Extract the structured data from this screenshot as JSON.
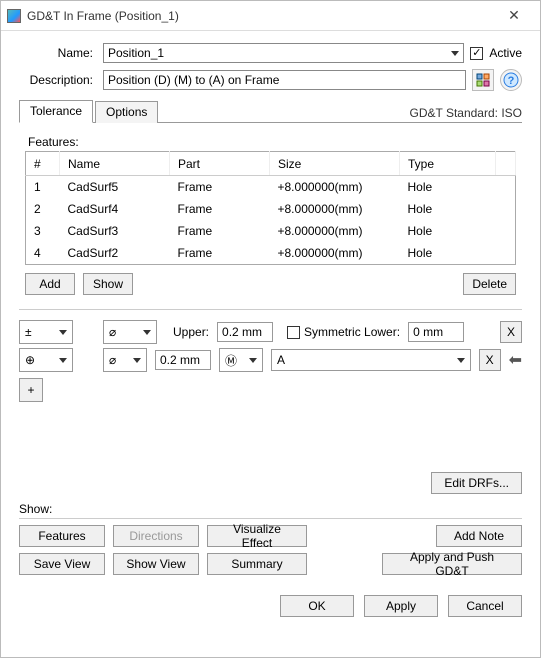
{
  "window": {
    "title": "GD&T In Frame (Position_1)"
  },
  "header": {
    "name_label": "Name:",
    "name_value": "Position_1",
    "active_label": "Active",
    "active_checked": true,
    "desc_label": "Description:",
    "desc_value": "Position (D) (M) to (A) on Frame"
  },
  "tabs": {
    "tolerance": "Tolerance",
    "options": "Options",
    "standard_label": "GD&T Standard: ISO"
  },
  "features": {
    "legend": "Features:",
    "columns": [
      "#",
      "Name",
      "Part",
      "Size",
      "Type"
    ],
    "rows": [
      {
        "n": "1",
        "name": "CadSurf5",
        "part": "Frame",
        "size": "+8.000000(mm)",
        "type": "Hole"
      },
      {
        "n": "2",
        "name": "CadSurf4",
        "part": "Frame",
        "size": "+8.000000(mm)",
        "type": "Hole"
      },
      {
        "n": "3",
        "name": "CadSurf3",
        "part": "Frame",
        "size": "+8.000000(mm)",
        "type": "Hole"
      },
      {
        "n": "4",
        "name": "CadSurf2",
        "part": "Frame",
        "size": "+8.000000(mm)",
        "type": "Hole"
      }
    ],
    "buttons": {
      "add": "Add",
      "show": "Show",
      "delete": "Delete"
    }
  },
  "tolerance_block": {
    "row1": {
      "symbol": "±",
      "diameter": "⌀",
      "upper_label": "Upper:",
      "upper_value": "0.2 mm",
      "sym_lower_label": "Symmetric Lower:",
      "sym_lower_checked": false,
      "lower_value": "0 mm",
      "x": "X"
    },
    "row2": {
      "symbol": "⊕",
      "diameter": "⌀",
      "value": "0.2 mm",
      "modifier": "Ⓜ",
      "datum": "A",
      "x": "X"
    },
    "plus": "+",
    "edit_drfs": "Edit DRFs..."
  },
  "show": {
    "legend": "Show:",
    "features": "Features",
    "directions": "Directions",
    "visualize": "Visualize Effect",
    "addnote": "Add Note",
    "saveview": "Save View",
    "showview": "Show View",
    "summary": "Summary",
    "applypush": "Apply and Push GD&T"
  },
  "footer": {
    "ok": "OK",
    "apply": "Apply",
    "cancel": "Cancel"
  }
}
